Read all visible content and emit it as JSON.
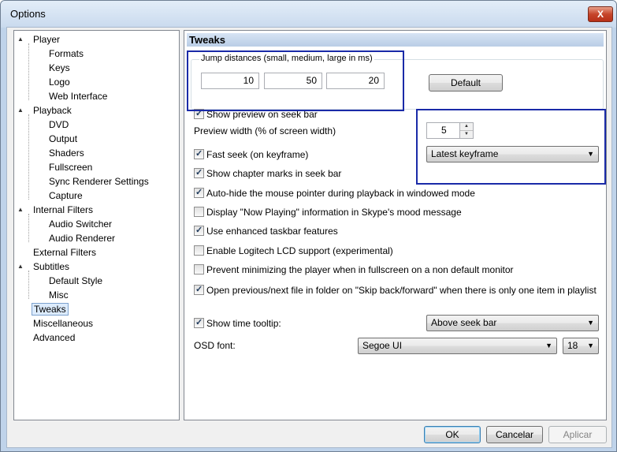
{
  "window": {
    "title": "Options",
    "close_glyph": "X"
  },
  "tree": {
    "items": [
      {
        "label": "Player",
        "level": 0,
        "expander": "▲"
      },
      {
        "label": "Formats",
        "level": 1
      },
      {
        "label": "Keys",
        "level": 1
      },
      {
        "label": "Logo",
        "level": 1
      },
      {
        "label": "Web Interface",
        "level": 1
      },
      {
        "label": "Playback",
        "level": 0,
        "expander": "▲"
      },
      {
        "label": "DVD",
        "level": 1
      },
      {
        "label": "Output",
        "level": 1
      },
      {
        "label": "Shaders",
        "level": 1
      },
      {
        "label": "Fullscreen",
        "level": 1
      },
      {
        "label": "Sync Renderer Settings",
        "level": 1
      },
      {
        "label": "Capture",
        "level": 1
      },
      {
        "label": "Internal Filters",
        "level": 0,
        "expander": "▲"
      },
      {
        "label": "Audio Switcher",
        "level": 1
      },
      {
        "label": "Audio Renderer",
        "level": 1
      },
      {
        "label": "External Filters",
        "level": 0
      },
      {
        "label": "Subtitles",
        "level": 0,
        "expander": "▲"
      },
      {
        "label": "Default Style",
        "level": 1
      },
      {
        "label": "Misc",
        "level": 1
      },
      {
        "label": "Tweaks",
        "level": 0,
        "selected": true
      },
      {
        "label": "Miscellaneous",
        "level": 0
      },
      {
        "label": "Advanced",
        "level": 0
      }
    ]
  },
  "panel": {
    "header": "Tweaks",
    "jump": {
      "label": "Jump distances (small, medium, large in ms)",
      "small": "10",
      "medium": "50",
      "large": "20",
      "default_button": "Default"
    },
    "show_preview": {
      "label": "Show preview on seek bar",
      "checked": true
    },
    "preview_width": {
      "label": "Preview width (% of screen width)",
      "value": "5"
    },
    "fast_seek": {
      "label": "Fast seek (on keyframe)",
      "checked": true,
      "mode": "Latest keyframe"
    },
    "chapter_marks": {
      "label": "Show chapter marks in seek bar",
      "checked": true
    },
    "autohide": {
      "label": "Auto-hide the mouse pointer during playback in windowed mode",
      "checked": true
    },
    "now_playing": {
      "label": "Display \"Now Playing\" information in Skype's mood message",
      "checked": false
    },
    "taskbar": {
      "label": "Use enhanced taskbar features",
      "checked": true
    },
    "logitech": {
      "label": "Enable Logitech LCD support (experimental)",
      "checked": false
    },
    "prevent_min": {
      "label": "Prevent minimizing the player when in fullscreen on a non default monitor",
      "checked": false
    },
    "open_next": {
      "label": "Open previous/next file in folder on \"Skip back/forward\" when there is only one item in playlist",
      "checked": true
    },
    "time_tooltip": {
      "label": "Show time tooltip:",
      "checked": true,
      "position": "Above seek bar"
    },
    "osd_font": {
      "label": "OSD font:",
      "font": "Segoe UI",
      "size": "18"
    }
  },
  "footer": {
    "ok": "OK",
    "cancel": "Cancelar",
    "apply": "Aplicar"
  },
  "colors": {
    "highlight_box": "#1a2aa8",
    "selection": "#dcebfc"
  }
}
